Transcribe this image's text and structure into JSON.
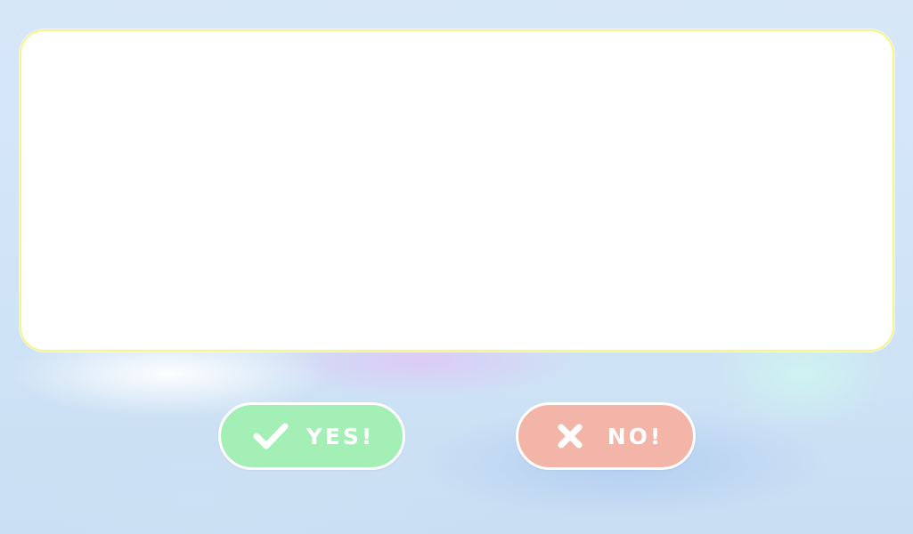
{
  "dialog": {
    "panel_text": ""
  },
  "buttons": {
    "yes": {
      "label": "YES!",
      "icon": "check-icon",
      "color": "#a4efb6"
    },
    "no": {
      "label": "NO!",
      "icon": "close-icon",
      "color": "#f3b5a8"
    }
  }
}
